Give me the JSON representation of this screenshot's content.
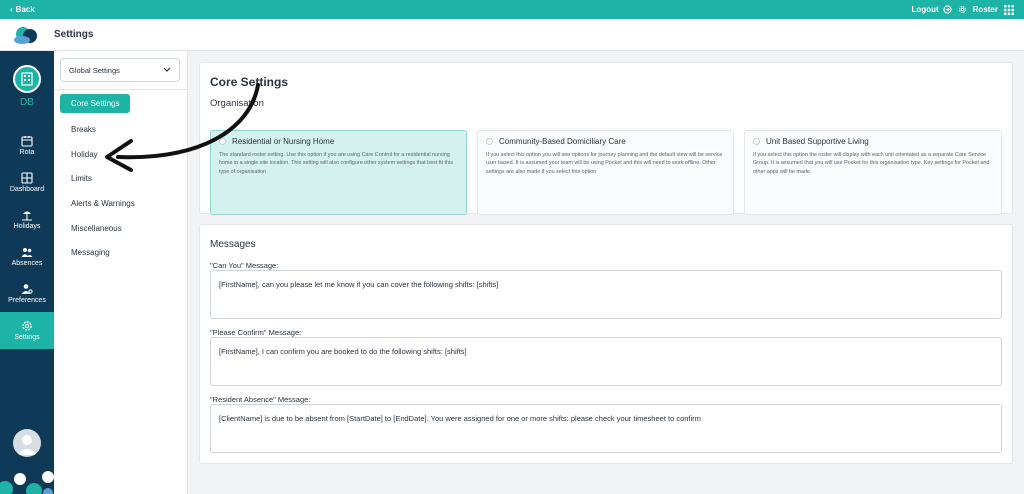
{
  "topbar": {
    "back_label": "Back",
    "logout_label": "Logout",
    "roster_label": "Roster"
  },
  "header": {
    "title": "Settings"
  },
  "rail": {
    "user_initials": "DB",
    "items": [
      {
        "label": "Rota",
        "icon": "calendar-icon"
      },
      {
        "label": "Dashboard",
        "icon": "dashboard-icon"
      },
      {
        "label": "Holidays",
        "icon": "beach-icon"
      },
      {
        "label": "Absences",
        "icon": "people-icon"
      },
      {
        "label": "Preferences",
        "icon": "user-settings-icon"
      },
      {
        "label": "Settings",
        "icon": "gear-icon"
      }
    ],
    "active": "Settings"
  },
  "subnav": {
    "select_value": "Global Settings",
    "items": [
      {
        "label": "Core Settings"
      },
      {
        "label": "Breaks"
      },
      {
        "label": "Holiday"
      },
      {
        "label": "Limits"
      },
      {
        "label": "Alerts & Warnings"
      },
      {
        "label": "Miscellaneous"
      },
      {
        "label": "Messaging"
      }
    ],
    "active": "Core Settings"
  },
  "core": {
    "title": "Core Settings",
    "organisation_label": "Organisation",
    "options": [
      {
        "title": "Residential or Nursing Home",
        "desc": "The standard roster setting. Use this option if you are using Care Control for a residential nursing home in a single site location. This setting will also configure other system settings that best fit this type of organisation",
        "selected": true
      },
      {
        "title": "Community-Based Domiciliary Care",
        "desc": "If you select this option you will see options for journey planning and the default view will be service user based. It is assumed your team will be using Pocket and this will need to work offline. Other settings are also made if you select this option",
        "selected": false
      },
      {
        "title": "Unit Based Supportive Living",
        "desc": "If you select this option the roster will display with each unit orientated as a separate Care Service Group. It is assumed that you will use Pocket for this organisation type. Key settings for Pocket and other apps will be made.",
        "selected": false
      }
    ]
  },
  "messages": {
    "title": "Messages",
    "fields": [
      {
        "label": "\"Can You\" Message:",
        "value": "[FirstName], can you please let me know if you can cover the following shifts: [shifts]"
      },
      {
        "label": "\"Please Confirm\" Message:",
        "value": "[FirstName], I can confirm you are booked to do the following shifts: [shifts]"
      },
      {
        "label": "\"Resident Absence\" Message:",
        "value": "[ClientName] is due to be absent from [StartDate] to [EndDate]. You were assigned for one or more shifts: please check your timesheet to confirm"
      }
    ]
  },
  "colors": {
    "accent": "#1db3a6",
    "rail": "#0f3a57",
    "selected_option": "#d5f1ee"
  }
}
